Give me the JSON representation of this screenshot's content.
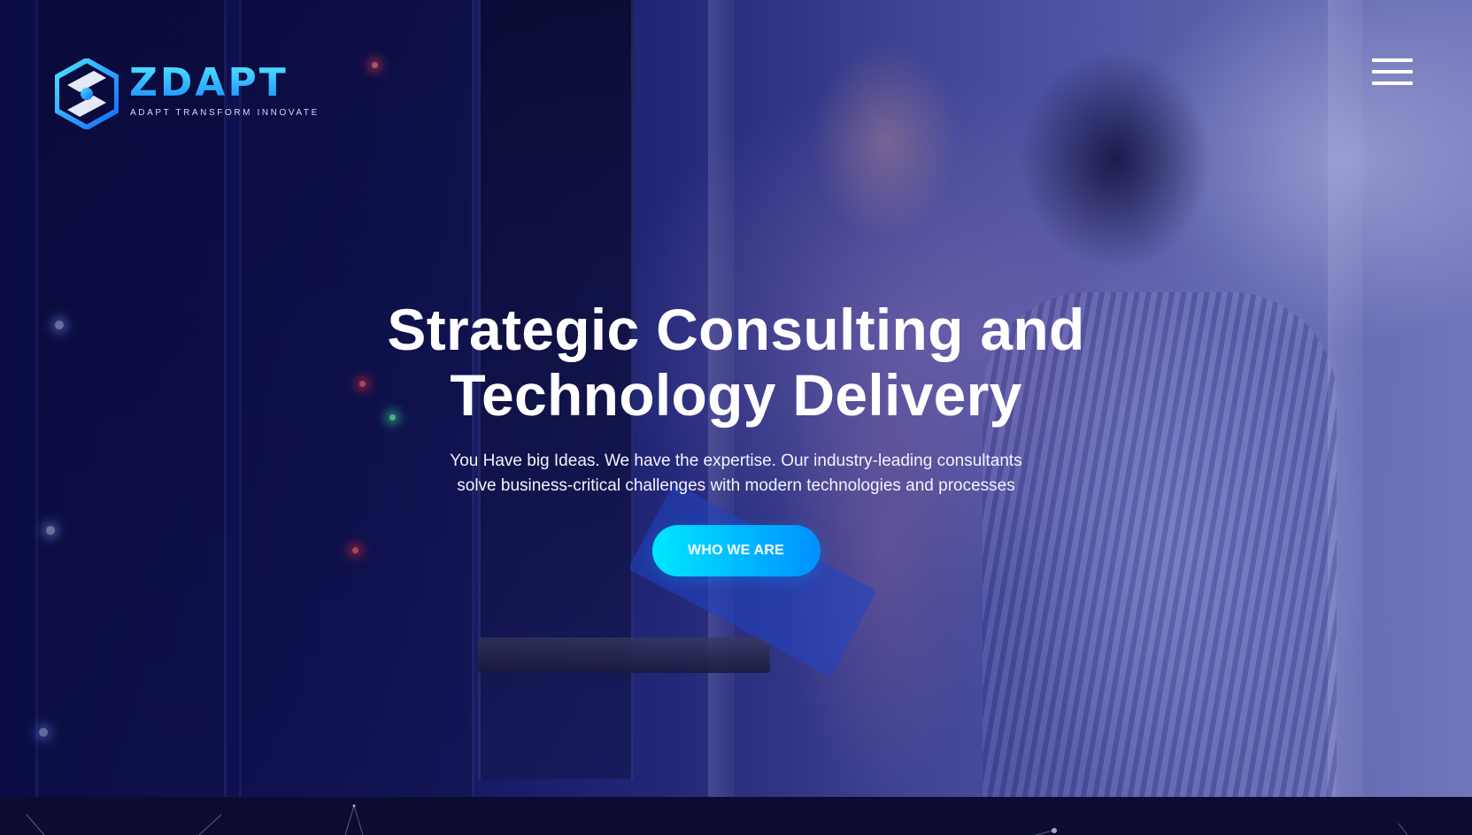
{
  "brand": {
    "name": "ZDAPT",
    "tagline": "ADAPT TRANSFORM INNOVATE",
    "colors": {
      "accent_light": "#00e8ff",
      "accent_dark": "#0090ff",
      "overlay": "#0d0f52"
    }
  },
  "header": {
    "menu_icon": "hamburger-menu-icon"
  },
  "hero": {
    "title_line1": "Strategic Consulting and",
    "title_line2": "Technology Delivery",
    "subtitle_line1": "You Have big Ideas. We have the expertise. Our industry-leading consultants",
    "subtitle_line2": "solve business-critical challenges with modern technologies and processes",
    "cta_label": "WHO WE ARE"
  }
}
